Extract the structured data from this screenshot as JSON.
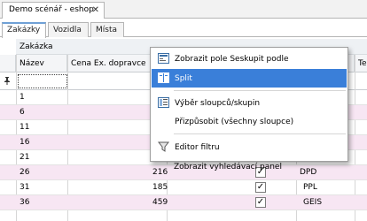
{
  "document_tab": {
    "title": "Demo scénář - eshop",
    "close": "✕"
  },
  "tabs": [
    {
      "label": "Zakázky",
      "active": true
    },
    {
      "label": "Vozidla",
      "active": false
    },
    {
      "label": "Místa",
      "active": false
    }
  ],
  "band": {
    "label": "Zakázka"
  },
  "headers": {
    "nazev": "Název",
    "cena": "Cena Ex. dopravce",
    "dopravce": "vce",
    "te": "Te"
  },
  "filter": {
    "pin_icon": "pin-icon",
    "value": ""
  },
  "rows": [
    {
      "nazev": "1",
      "cena": "",
      "checked": false,
      "dopravce": ""
    },
    {
      "nazev": "6",
      "cena": "",
      "checked": false,
      "dopravce": ""
    },
    {
      "nazev": "11",
      "cena": "",
      "checked": false,
      "dopravce": ""
    },
    {
      "nazev": "16",
      "cena": "",
      "checked": false,
      "dopravce": ""
    },
    {
      "nazev": "21",
      "cena": "",
      "checked": false,
      "dopravce": ""
    },
    {
      "nazev": "26",
      "cena": "216",
      "checked": true,
      "dopravce": "DPD"
    },
    {
      "nazev": "31",
      "cena": "185",
      "checked": true,
      "dopravce": "PPL"
    },
    {
      "nazev": "36",
      "cena": "459",
      "checked": true,
      "dopravce": "GEIS"
    }
  ],
  "context_menu": {
    "items": [
      {
        "label": "Zobrazit pole Seskupit podle",
        "icon": "group-by-icon",
        "highlighted": false
      },
      {
        "label": "Split",
        "icon": "split-icon",
        "highlighted": true
      },
      {
        "label": "Výběr sloupců/skupin",
        "icon": "column-chooser-icon",
        "highlighted": false
      },
      {
        "label": "Přizpůsobit (všechny sloupce)",
        "icon": "",
        "highlighted": false
      },
      {
        "label": "Editor filtru",
        "icon": "filter-icon",
        "highlighted": false
      },
      {
        "label": "Zobrazit vyhledávací panel",
        "icon": "",
        "highlighted": false
      }
    ]
  },
  "colors": {
    "highlight": "#3a7fd9",
    "alt_row": "#f7e6f3",
    "active_tab_accent": "#6fa0d6"
  }
}
